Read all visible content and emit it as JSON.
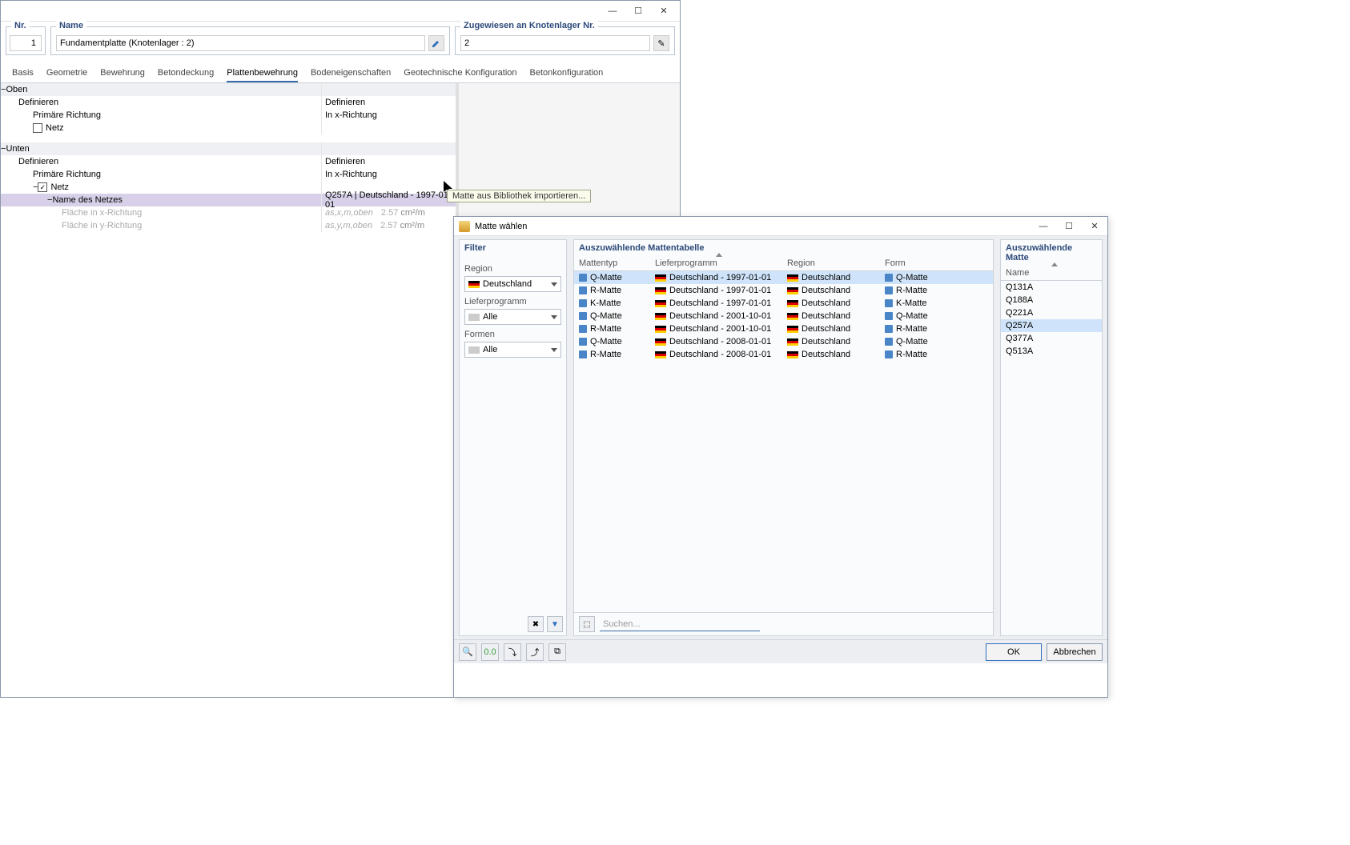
{
  "win1": {
    "header": {
      "nr_label": "Nr.",
      "nr_value": "1",
      "name_label": "Name",
      "name_value": "Fundamentplatte (Knotenlager : 2)",
      "assign_label": "Zugewiesen an Knotenlager Nr.",
      "assign_value": "2"
    },
    "tabs": [
      "Basis",
      "Geometrie",
      "Bewehrung",
      "Betondeckung",
      "Plattenbewehrung",
      "Bodeneigenschaften",
      "Geotechnische Konfiguration",
      "Betonkonfiguration"
    ],
    "active_tab": 4,
    "tree": {
      "oben": "Oben",
      "unten": "Unten",
      "definieren": "Definieren",
      "prim": "Primäre Richtung",
      "netz": "Netz",
      "def_val": "Definieren",
      "in_x": "In x-Richtung",
      "name_netz": "Name des Netzes",
      "name_netz_val": "Q257A | Deutschland - 1997-01-01",
      "flx": "Fläche in x-Richtung",
      "fly": "Fläche in y-Richtung",
      "flx_var": "as,x,m,oben",
      "fly_var": "as,y,m,oben",
      "val257": "2.57",
      "unit": "cm²/m"
    },
    "tooltip": "Matte aus Bibliothek importieren..."
  },
  "win2": {
    "title": "Matte wählen",
    "filter_label": "Filter",
    "region_label": "Region",
    "region_value": "Deutschland",
    "prog_label": "Lieferprogramm",
    "prog_value": "Alle",
    "form_label": "Formen",
    "form_value": "Alle",
    "table": {
      "header_label": "Auszuwählende Mattentabelle",
      "cols": [
        "Mattentyp",
        "Lieferprogramm",
        "Region",
        "Form"
      ],
      "rows": [
        {
          "mt": "Q-Matte",
          "lp": "Deutschland - 1997-01-01",
          "rg": "Deutschland",
          "fm": "Q-Matte",
          "sel": true
        },
        {
          "mt": "R-Matte",
          "lp": "Deutschland - 1997-01-01",
          "rg": "Deutschland",
          "fm": "R-Matte"
        },
        {
          "mt": "K-Matte",
          "lp": "Deutschland - 1997-01-01",
          "rg": "Deutschland",
          "fm": "K-Matte"
        },
        {
          "mt": "Q-Matte",
          "lp": "Deutschland - 2001-10-01",
          "rg": "Deutschland",
          "fm": "Q-Matte"
        },
        {
          "mt": "R-Matte",
          "lp": "Deutschland - 2001-10-01",
          "rg": "Deutschland",
          "fm": "R-Matte"
        },
        {
          "mt": "Q-Matte",
          "lp": "Deutschland - 2008-01-01",
          "rg": "Deutschland",
          "fm": "Q-Matte"
        },
        {
          "mt": "R-Matte",
          "lp": "Deutschland - 2008-01-01",
          "rg": "Deutschland",
          "fm": "R-Matte"
        }
      ]
    },
    "sel": {
      "header": "Auszuwählende Matte",
      "name_col": "Name",
      "items": [
        {
          "n": "Q131A"
        },
        {
          "n": "Q188A"
        },
        {
          "n": "Q221A"
        },
        {
          "n": "Q257A",
          "sel": true
        },
        {
          "n": "Q377A"
        },
        {
          "n": "Q513A"
        }
      ]
    },
    "search_placeholder": "Suchen...",
    "ok": "OK",
    "cancel": "Abbrechen"
  }
}
